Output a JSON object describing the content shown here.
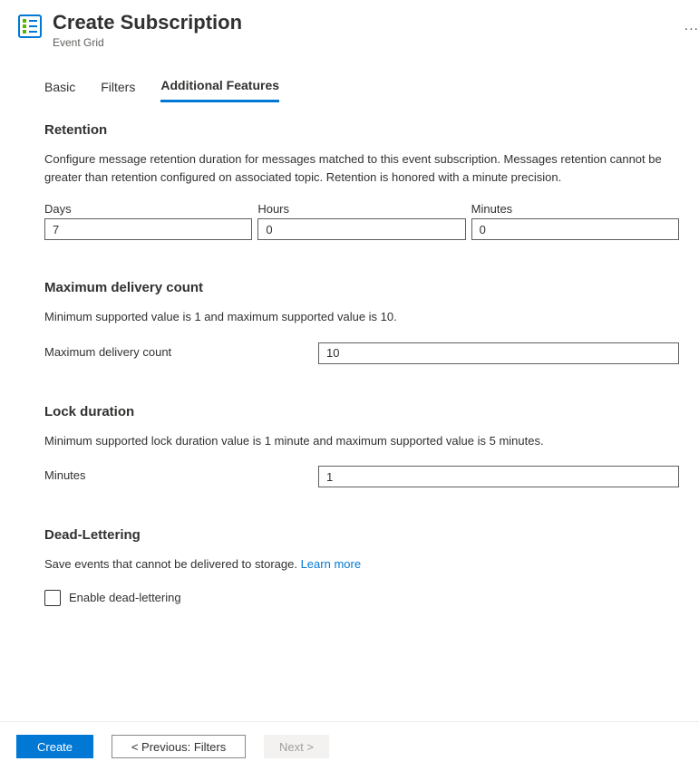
{
  "header": {
    "title": "Create Subscription",
    "subtitle": "Event Grid",
    "more_label": "..."
  },
  "tabs": {
    "basic": "Basic",
    "filters": "Filters",
    "additional": "Additional Features"
  },
  "retention": {
    "title": "Retention",
    "desc": "Configure message retention duration for messages matched to this event subscription. Messages retention cannot be greater than retention configured on associated topic. Retention is honored with a minute precision.",
    "days_label": "Days",
    "days_value": "7",
    "hours_label": "Hours",
    "hours_value": "0",
    "minutes_label": "Minutes",
    "minutes_value": "0"
  },
  "max_delivery": {
    "title": "Maximum delivery count",
    "desc": "Minimum supported value is 1 and maximum supported value is 10.",
    "label": "Maximum delivery count",
    "value": "10"
  },
  "lock_duration": {
    "title": "Lock duration",
    "desc": "Minimum supported lock duration value is 1 minute and maximum supported value is 5 minutes.",
    "label": "Minutes",
    "value": "1"
  },
  "dead_lettering": {
    "title": "Dead-Lettering",
    "desc": "Save events that cannot be delivered to storage. ",
    "learn_more": "Learn more",
    "checkbox_label": "Enable dead-lettering"
  },
  "footer": {
    "create": "Create",
    "previous": "< Previous: Filters",
    "next": "Next >"
  }
}
